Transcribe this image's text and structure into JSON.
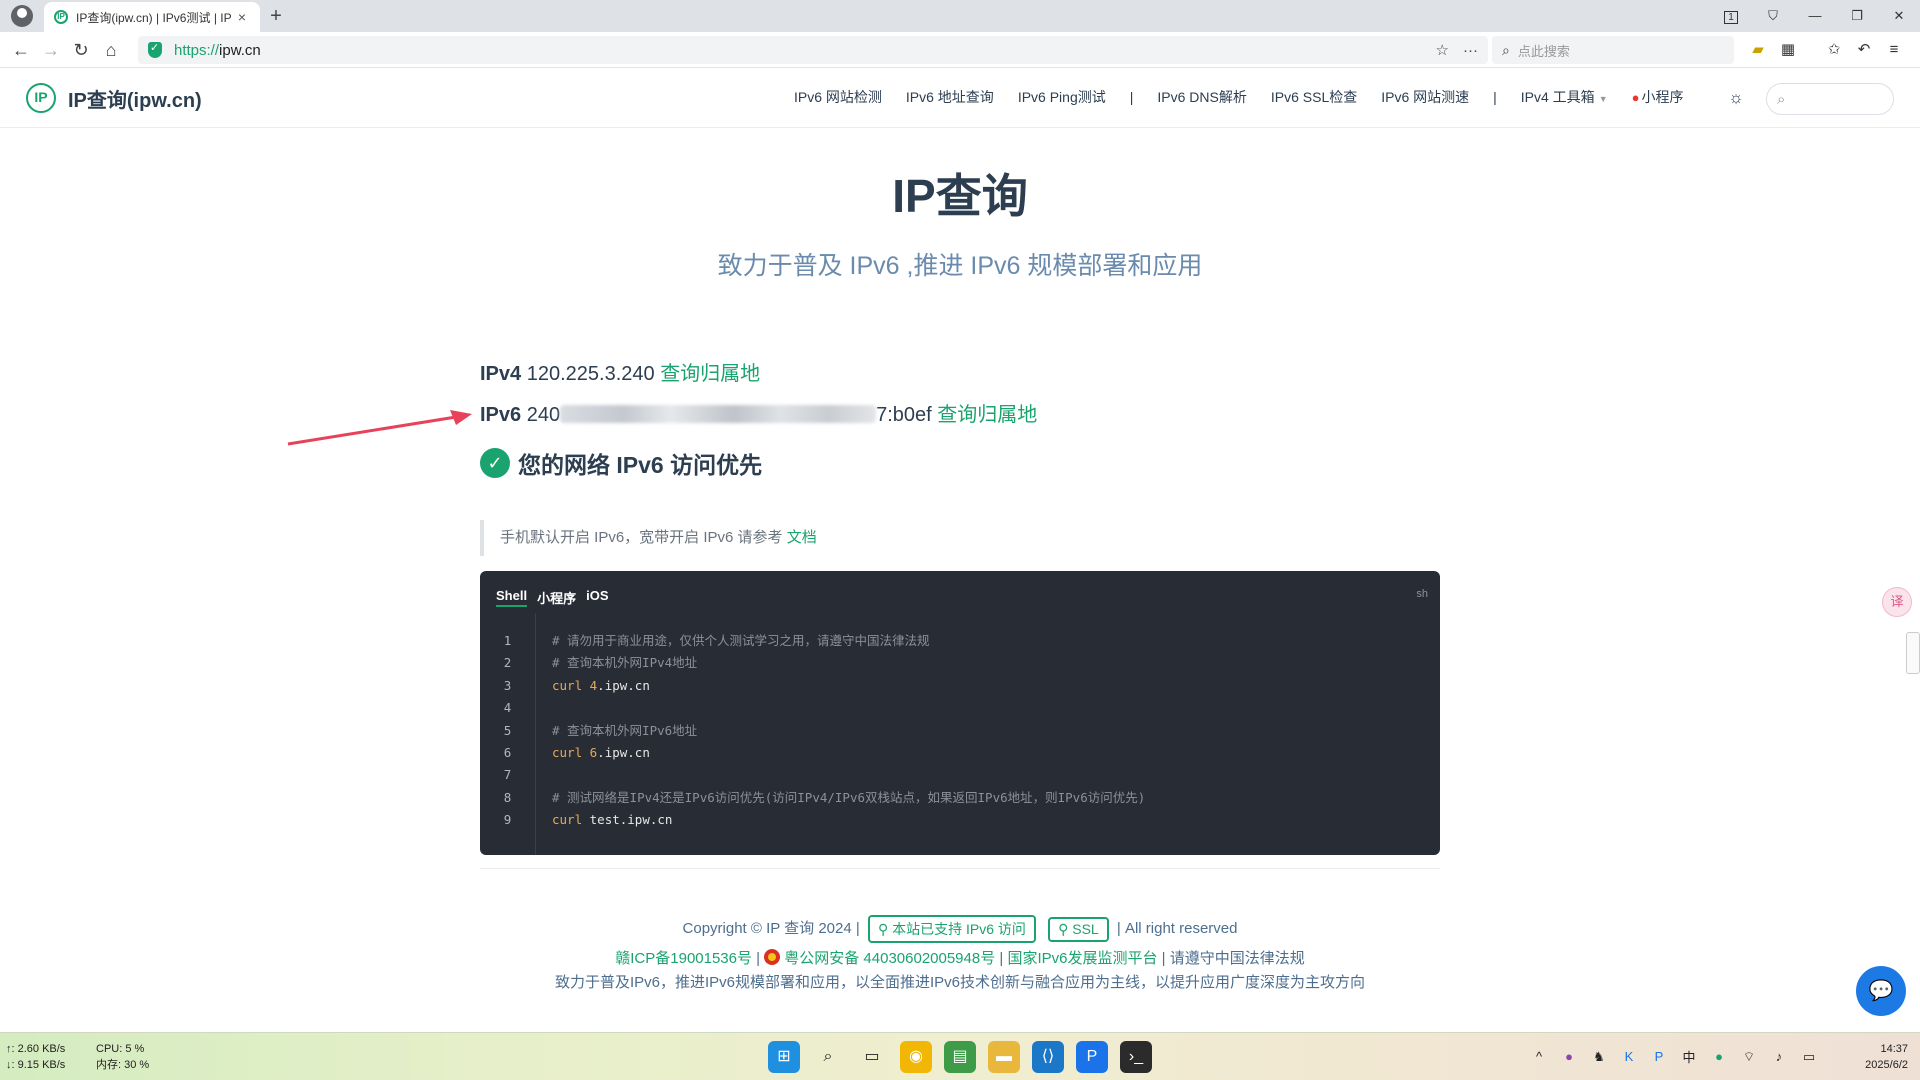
{
  "browser": {
    "tab_title": "IP查询(ipw.cn) | IPv6测试 | IP",
    "tab_favicon": "IP",
    "new_tab": "+",
    "tab_close": "×",
    "url_proto": "https://",
    "url_host": "ipw.cn",
    "search_placeholder": "点此搜索",
    "window_counter": "1"
  },
  "site": {
    "logo_mark": "IP",
    "logo_text": "IP查询(ipw.cn)",
    "nav": [
      "IPv6 网站检测",
      "IPv6 地址查询",
      "IPv6 Ping测试",
      "IPv6 DNS解析",
      "IPv6 SSL检查",
      "IPv6 网站测速",
      "IPv4 工具箱",
      "小程序"
    ],
    "nav_sep": "|"
  },
  "hero": {
    "title": "IP查询",
    "subtitle": "致力于普及 IPv6 ,推进 IPv6 规模部署和应用"
  },
  "ip": {
    "ipv4_label": "IPv4",
    "ipv4_value": "120.225.3.240",
    "ipv4_link": "查询归属地",
    "ipv6_label": "IPv6",
    "ipv6_prefix": "240",
    "ipv6_suffix": "7:b0ef",
    "ipv6_link": "查询归属地",
    "status": "您的网络 IPv6 访问优先"
  },
  "tip": {
    "text": "手机默认开启 IPv6，宽带开启 IPv6 请参考",
    "link": "文档"
  },
  "code": {
    "tabs": [
      "Shell",
      "小程序",
      "iOS"
    ],
    "lang": "sh",
    "line_numbers": [
      "1",
      "2",
      "3",
      "4",
      "5",
      "6",
      "7",
      "8",
      "9"
    ],
    "lines": [
      {
        "type": "comment",
        "text": "# 请勿用于商业用途，仅供个人测试学习之用，请遵守中国法律法规"
      },
      {
        "type": "comment",
        "text": "# 查询本机外网IPv4地址"
      },
      {
        "type": "cmd",
        "cmd": "curl",
        "num": "4",
        "rest": ".ipw.cn"
      },
      {
        "type": "blank",
        "text": ""
      },
      {
        "type": "comment",
        "text": "# 查询本机外网IPv6地址"
      },
      {
        "type": "cmd",
        "cmd": "curl",
        "num": "6",
        "rest": ".ipw.cn"
      },
      {
        "type": "blank",
        "text": ""
      },
      {
        "type": "comment",
        "text": "# 测试网络是IPv4还是IPv6访问优先(访问IPv4/IPv6双栈站点，如果返回IPv6地址，则IPv6访问优先)"
      },
      {
        "type": "cmd",
        "cmd": "curl",
        "num": "",
        "rest": "test.ipw.cn"
      }
    ]
  },
  "footer": {
    "copyright": "Copyright © IP 查询 2024 |",
    "badge_ipv6": "本站已支持 IPv6 访问",
    "badge_ssl": "SSL",
    "rights": "| All right reserved",
    "icp": "赣ICP备19001536号",
    "sep": "|",
    "police": "粤公网安备 44030602005948号",
    "monitor": "国家IPv6发展监测平台",
    "law": "请遵守中国法律法规",
    "mission": "致力于普及IPv6，推进IPv6规模部署和应用，以全面推进IPv6技术创新与融合应用为主线，以提升应用广度深度为主攻方向"
  },
  "taskbar": {
    "net_up": "↑: 2.60 KB/s",
    "net_down": "↓: 9.15 KB/s",
    "cpu": "CPU: 5 %",
    "mem": "内存: 30 %",
    "ime": "中",
    "time": "14:37",
    "date": "2025/6/2"
  },
  "colors": {
    "accent": "#1aa36f",
    "subtitle": "#6a8bad",
    "code_bg": "#282c34",
    "arrow": "#e8415a"
  }
}
